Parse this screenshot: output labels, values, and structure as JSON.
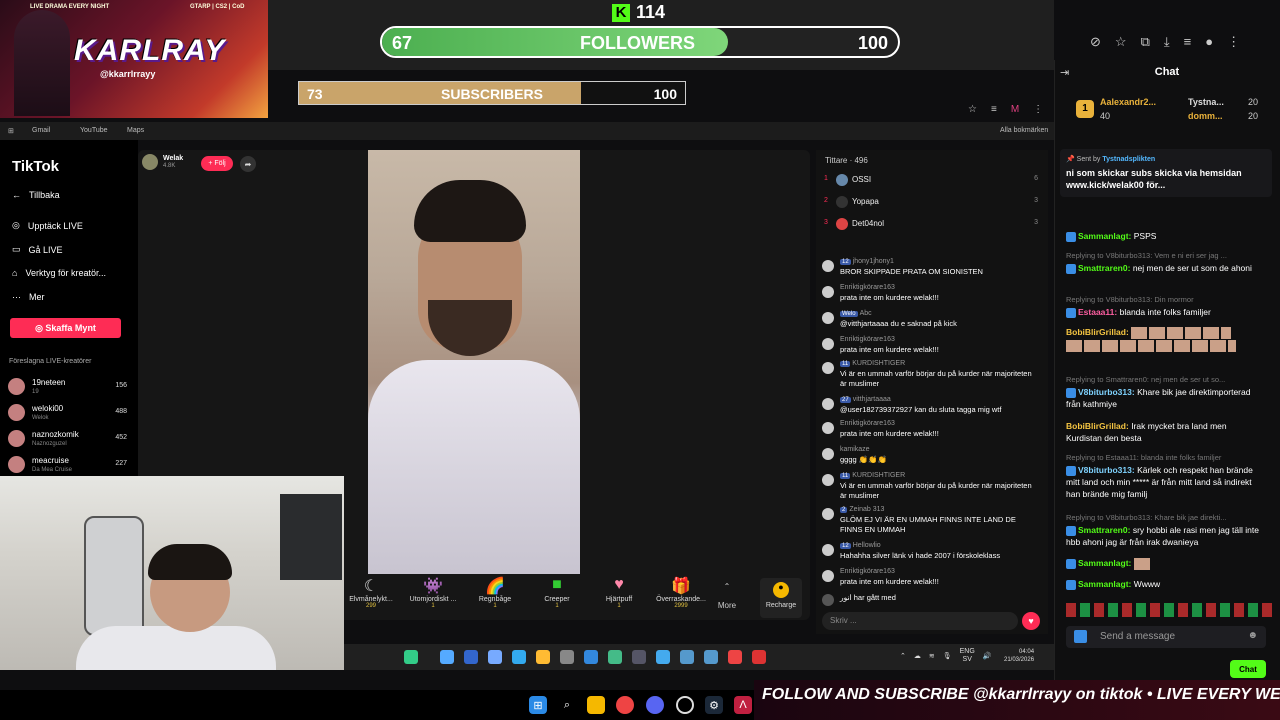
{
  "overlay": {
    "banner_tagline": "LIVE DRAMA EVERY NIGHT",
    "banner_games": "GTARP | CS2 | CoD",
    "banner_name": "KARLRAY",
    "banner_handle": "@kkarrlrrayy",
    "kick_count": "114",
    "followers_current": "67",
    "followers_label": "FOLLOWERS",
    "followers_goal": "100",
    "followers_progress": 0.67,
    "subs_current": "73",
    "subs_label": "SUBSCRIBERS",
    "subs_goal": "100",
    "subs_progress": 0.73,
    "ticker": "FOLLOW AND SUBSCRIBE @kkarrlrrayy on tiktok • LIVE EVERY WEEK",
    "accent": "#53fc18"
  },
  "bookmarks": {
    "gmail": "Gmail",
    "youtube": "YouTube",
    "maps": "Maps",
    "all": "Alla bokmärken"
  },
  "tiktok": {
    "logo": "TikTok",
    "nav": [
      "Tillbaka",
      "Upptäck LIVE",
      "Gå LIVE",
      "Verktyg för kreatör...",
      "Mer"
    ],
    "buy_button": "Skaffa Mynt",
    "suggested_header": "Föreslagna LIVE-kreatörer",
    "creators": [
      {
        "name": "19neteen",
        "sub": "19",
        "count": "156"
      },
      {
        "name": "weloki00",
        "sub": "Welok",
        "count": "488"
      },
      {
        "name": "naznozkomik",
        "sub": "Naznozguzel",
        "count": "452"
      },
      {
        "name": "meacruise",
        "sub": "Da Mea Cruise",
        "count": "227"
      }
    ],
    "host_name": "Welak",
    "host_sub": "4.8K",
    "follow_button": "+ Följ",
    "gifts": [
      {
        "name": "Elvmånelykt...",
        "price": "299"
      },
      {
        "name": "Utomjordiskt ...",
        "price": "1"
      },
      {
        "name": "Regnbåge",
        "price": "1"
      },
      {
        "name": "Creeper",
        "price": "1"
      },
      {
        "name": "Hjärtpuff",
        "price": "1"
      },
      {
        "name": "Överraskande...",
        "price": "2999"
      }
    ],
    "more_label": "More",
    "recharge_label": "Recharge",
    "viewers_header": "Tittare · 496",
    "viewers": [
      {
        "rank": "1",
        "name": "OSSI",
        "count": "6"
      },
      {
        "rank": "2",
        "name": "Yopapa",
        "count": "3"
      },
      {
        "rank": "3",
        "name": "Det04nol",
        "count": "3"
      }
    ],
    "messages": [
      {
        "user": "jhony1jhony1",
        "level": "12",
        "text": "BROR SKIPPADE PRATA OM SIONISTEN"
      },
      {
        "user": "Enriktigkörare163",
        "level": "",
        "text": "prata inte om kurdere welak!!!"
      },
      {
        "user": "Abc",
        "level": "Welo",
        "text": "@vitthjartaaaa du e saknad på kick"
      },
      {
        "user": "Enriktigkörare163",
        "level": "",
        "text": "prata inte om kurdere welak!!!"
      },
      {
        "user": "KURDISHTIGER",
        "level": "11",
        "text": "Vi är en ummah varför börjar du på kurder när majoriteten är muslimer"
      },
      {
        "user": "vitthjartaaaa",
        "level": "27",
        "text": "@user182739372927 kan du sluta tagga mig wtf"
      },
      {
        "user": "Enriktigkörare163",
        "level": "",
        "text": "prata inte om kurdere welak!!!"
      },
      {
        "user": "kamikaze",
        "level": "",
        "text": "gggg 👏👏👏"
      },
      {
        "user": "KURDISHTIGER",
        "level": "11",
        "text": "Vi är en ummah varför börjar du på kurder när majoriteten är muslimer"
      },
      {
        "user": "Zeinab 313",
        "level": "2",
        "text": "GLÖM EJ VI ÄR EN UMMAH FINNS INTE LAND DE FINNS EN UMMAH"
      },
      {
        "user": "Hellowlio",
        "level": "12",
        "text": "Hahahha silver länk vi hade 2007 i förskoleklass"
      },
      {
        "user": "Enriktigkörare163",
        "level": "",
        "text": "prata inte om kurdere welak!!!"
      },
      {
        "user": "انور",
        "level": "",
        "text": "har gått med"
      }
    ],
    "input_placeholder": "Skriv ..."
  },
  "taskbar": {
    "lang": "ENG",
    "region": "SV",
    "time": "04:04",
    "date": "21/03/2026"
  },
  "kick_chat": {
    "title": "Chat",
    "top_gifters": [
      {
        "name": "Aalexandr2...",
        "count": "40"
      },
      {
        "name": "Tystna...",
        "count": "20"
      },
      {
        "name": "domm...",
        "count": "20"
      }
    ],
    "pinned_sent_by": "Sent by",
    "pinned_user": "Tystnadsplikten",
    "pinned_text": "ni som skickar subs skicka via hemsidan www.kick/welak00 för...",
    "messages": [
      {
        "reply": "",
        "name": "Sammanlagt:",
        "color": "#53fc18",
        "text": "PSPS"
      },
      {
        "reply": "Replying to V8biturbo313: Vem e ni eri ser jag ...",
        "name": "Smattraren0:",
        "color": "#53fc18",
        "text": "nej men de ser ut som de ahoni"
      },
      {
        "reply": "Replying to V8biturbo313: Din mormor",
        "name": "Estaaa11:",
        "color": "#ff5fa2",
        "text": "blanda inte folks familjer"
      },
      {
        "reply": "",
        "name": "BobiBlirGrillad:",
        "color": "#f5c542",
        "text": ""
      },
      {
        "reply": "Replying to Smattraren0: nej men de ser ut so...",
        "name": "V8biturbo313:",
        "color": "#7fd3ff",
        "text": "Khare bik jae direktimporterad från kathmiye"
      },
      {
        "reply": "",
        "name": "BobiBlirGrillad:",
        "color": "#f5c542",
        "text": "Irak mycket bra land men Kurdistan den besta"
      },
      {
        "reply": "Replying to Estaaa11: blanda inte folks familjer",
        "name": "V8biturbo313:",
        "color": "#7fd3ff",
        "text": "Kärlek och respekt han brände mitt land och min ***** är från mitt land så indirekt han brände mig familj"
      },
      {
        "reply": "Replying to V8biturbo313: Khare bik jae direkti...",
        "name": "Smattraren0:",
        "color": "#53fc18",
        "text": "sry hobbi ale rasi men jag täll inte hbb ahoni jag är från irak dwanieya"
      },
      {
        "reply": "",
        "name": "Sammanlagt:",
        "color": "#53fc18",
        "text": ""
      },
      {
        "reply": "",
        "name": "Sammanlagt:",
        "color": "#53fc18",
        "text": "Wwww"
      }
    ],
    "input_placeholder": "Send a message",
    "chat_button": "Chat"
  }
}
